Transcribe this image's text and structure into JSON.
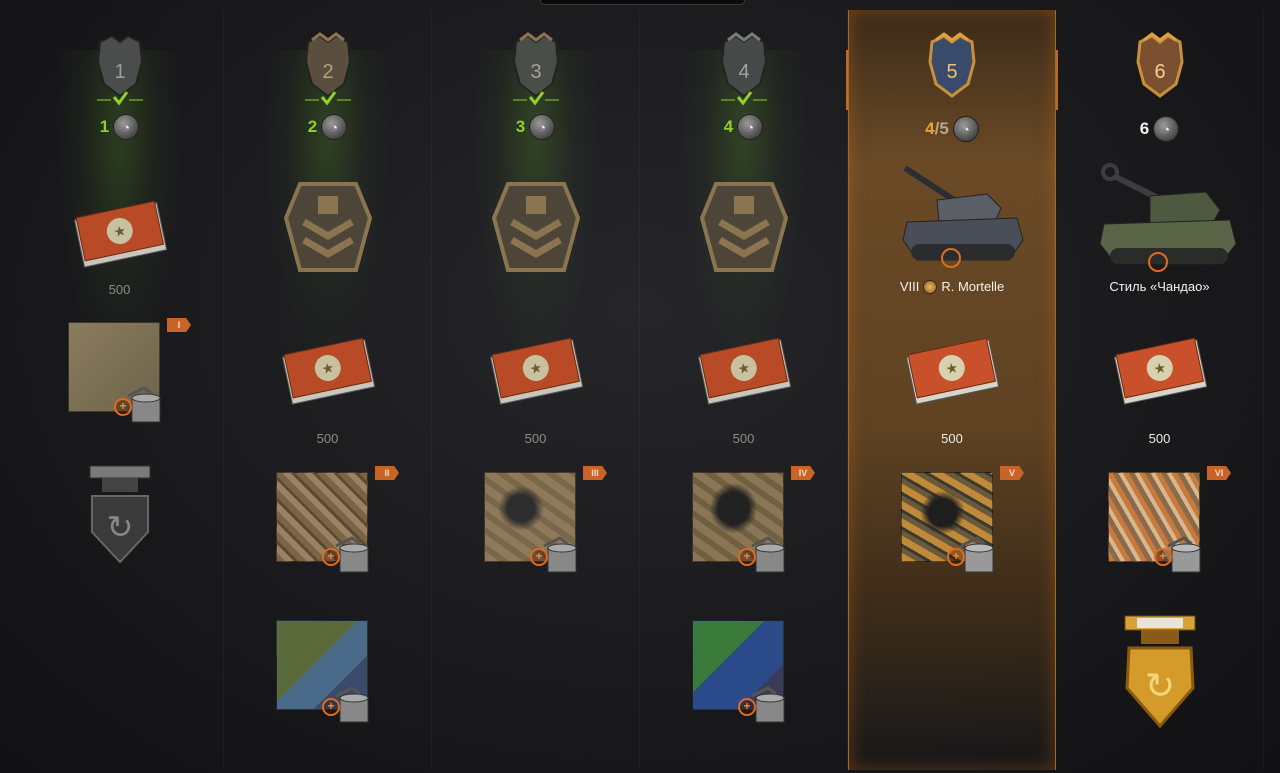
{
  "stages": [
    {
      "stage_number": "1",
      "state": "complete",
      "progress": "1",
      "check_icon": "checkmark-icon",
      "rewards": [
        {
          "type": "booster-pack",
          "label": "500"
        },
        {
          "type": "camo",
          "tier": "I",
          "pattern": "plain-khaki"
        },
        {
          "type": "badge",
          "name": "silver-shield-badge"
        }
      ]
    },
    {
      "stage_number": "2",
      "state": "complete",
      "progress": "2",
      "check_icon": "checkmark-icon",
      "rewards": [
        {
          "type": "chevron-emblem"
        },
        {
          "type": "booster-pack",
          "label": "500"
        },
        {
          "type": "camo",
          "tier": "II",
          "pattern": "streaked-desert"
        },
        {
          "type": "camo",
          "pattern": "digital-green-blue"
        }
      ]
    },
    {
      "stage_number": "3",
      "state": "complete",
      "progress": "3",
      "check_icon": "checkmark-icon",
      "rewards": [
        {
          "type": "chevron-emblem"
        },
        {
          "type": "booster-pack",
          "label": "500"
        },
        {
          "type": "camo",
          "tier": "III",
          "pattern": "dark-strokes-desert"
        }
      ]
    },
    {
      "stage_number": "4",
      "state": "complete",
      "progress": "4",
      "check_icon": "checkmark-icon",
      "rewards": [
        {
          "type": "chevron-emblem"
        },
        {
          "type": "booster-pack",
          "label": "500"
        },
        {
          "type": "camo",
          "tier": "IV",
          "pattern": "dark-strokes-desert"
        },
        {
          "type": "camo",
          "pattern": "digital-green-blue"
        }
      ]
    },
    {
      "stage_number": "5",
      "state": "current",
      "progress": "4",
      "progress_total": "5",
      "rewards": [
        {
          "type": "vehicle",
          "tier": "VIII",
          "name": "R. Mortelle"
        },
        {
          "type": "booster-pack",
          "label": "500"
        },
        {
          "type": "camo",
          "tier": "V",
          "pattern": "dark-strokes-orange"
        }
      ]
    },
    {
      "stage_number": "6",
      "state": "future",
      "progress": "6",
      "rewards": [
        {
          "type": "style",
          "label": "Стиль «Чандао»"
        },
        {
          "type": "booster-pack",
          "label": "500"
        },
        {
          "type": "camo",
          "tier": "VI",
          "pattern": "orange-veins"
        },
        {
          "type": "badge",
          "name": "gold-shield-badge"
        }
      ]
    }
  ],
  "colors": {
    "complete_green": "#8fd12a",
    "current_orange": "#f0a23a",
    "accent_highlight": "#a0682a",
    "tier_tag": "#c86428"
  }
}
